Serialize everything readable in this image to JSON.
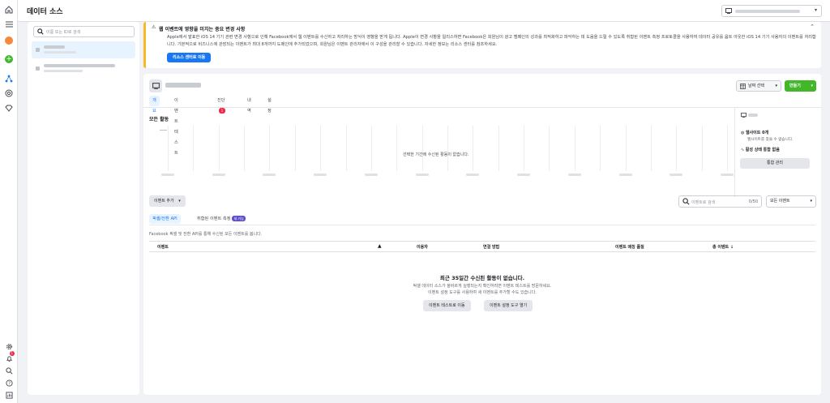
{
  "header": {
    "title": "데이터 소스"
  },
  "sidebar_search": {
    "placeholder": "이름 또는 ID로 검색"
  },
  "notice": {
    "title": "웹 이벤트에 영향을 미치는 중요 변경 사항",
    "body": "Apple에서 발표한 iOS 14 기기 관련 변경 사항으로 인해 Facebook에서 웹 이벤트를 수신하고 처리하는 방식이 영향을 받게 됩니다. Apple이 변경 사항을 일리스하면 Facebook은 회원님이 광고 캠페인의 성과를 최적화하고 파악하는 데 도움을 드릴 수 있도록 취합된 이벤트 측정 프로토콜을 사용하여 데이터 공유를 옵트 아웃한 iOS 14 기기 사용자의 이벤트를 처리합니다. 기본적으로 비즈니스에 관장되는 이벤트가 최대 8개까지 도메인에 추가되었으며, 회원님은 이벤트 관리자에서 이 구성을 관리할 수 있습니다. 자세한 정보는 리소스 센터를 참조하세요.",
    "button": "리소스 센터로 이동"
  },
  "toolbar": {
    "date_label": "날짜 선택",
    "create_label": "만들기"
  },
  "tabs": [
    {
      "label": "개요"
    },
    {
      "label": "이벤트 테스트"
    },
    {
      "label": "진단",
      "badge": "1"
    },
    {
      "label": "내역"
    },
    {
      "label": "설정"
    }
  ],
  "chart": {
    "title": "모든 활동",
    "empty_message": "선택한 기간에 수신된 활동이 없습니다."
  },
  "chart_data": {
    "type": "line",
    "title": "모든 활동",
    "x": [
      "",
      "",
      "",
      "",
      "",
      "",
      "",
      "",
      "",
      "",
      "",
      "",
      "",
      "",
      "",
      "",
      "",
      "",
      "",
      "",
      "",
      "",
      ""
    ],
    "values": [],
    "note_empty": true
  },
  "side": {
    "website_title": "웹사이트 0개",
    "website_sub": "웹사이트를 찾을 수 없습니다.",
    "integration": "활성 상태 통합 없음",
    "manage_btn": "통합 관리"
  },
  "events": {
    "add_label": "이벤트 추가",
    "search_placeholder": "이벤트로 검색",
    "search_count": "0/50",
    "filter_label": "모든 이벤트",
    "subtabs": [
      {
        "label": "픽셀/전환 API"
      },
      {
        "label": "취합된 이벤트 측정",
        "badge": "새 기능"
      }
    ],
    "description": "Facebook 픽셀 및 전환 API를 통해 수신된 모든 이벤트를 봅니다.",
    "columns": [
      "이벤트",
      "이용자",
      "연결 방법",
      "이벤트 매칭 품질",
      "총 이벤트 ↓"
    ],
    "empty_title": "최근 35일간 수신된 활동이 없습니다.",
    "empty_line1": "픽셀 데이터 소스가 올바르게 실행되는지 확인하려면 이벤트 테스트를 방문하세요.",
    "empty_line2": "이벤트 설정 도구를 사용하여 새 이벤트를 추가할 수도 있습니다.",
    "btn_test": "이벤트 테스트로 이동",
    "btn_setup": "이벤트 설정 도구 열기"
  },
  "rail_badge": "1"
}
